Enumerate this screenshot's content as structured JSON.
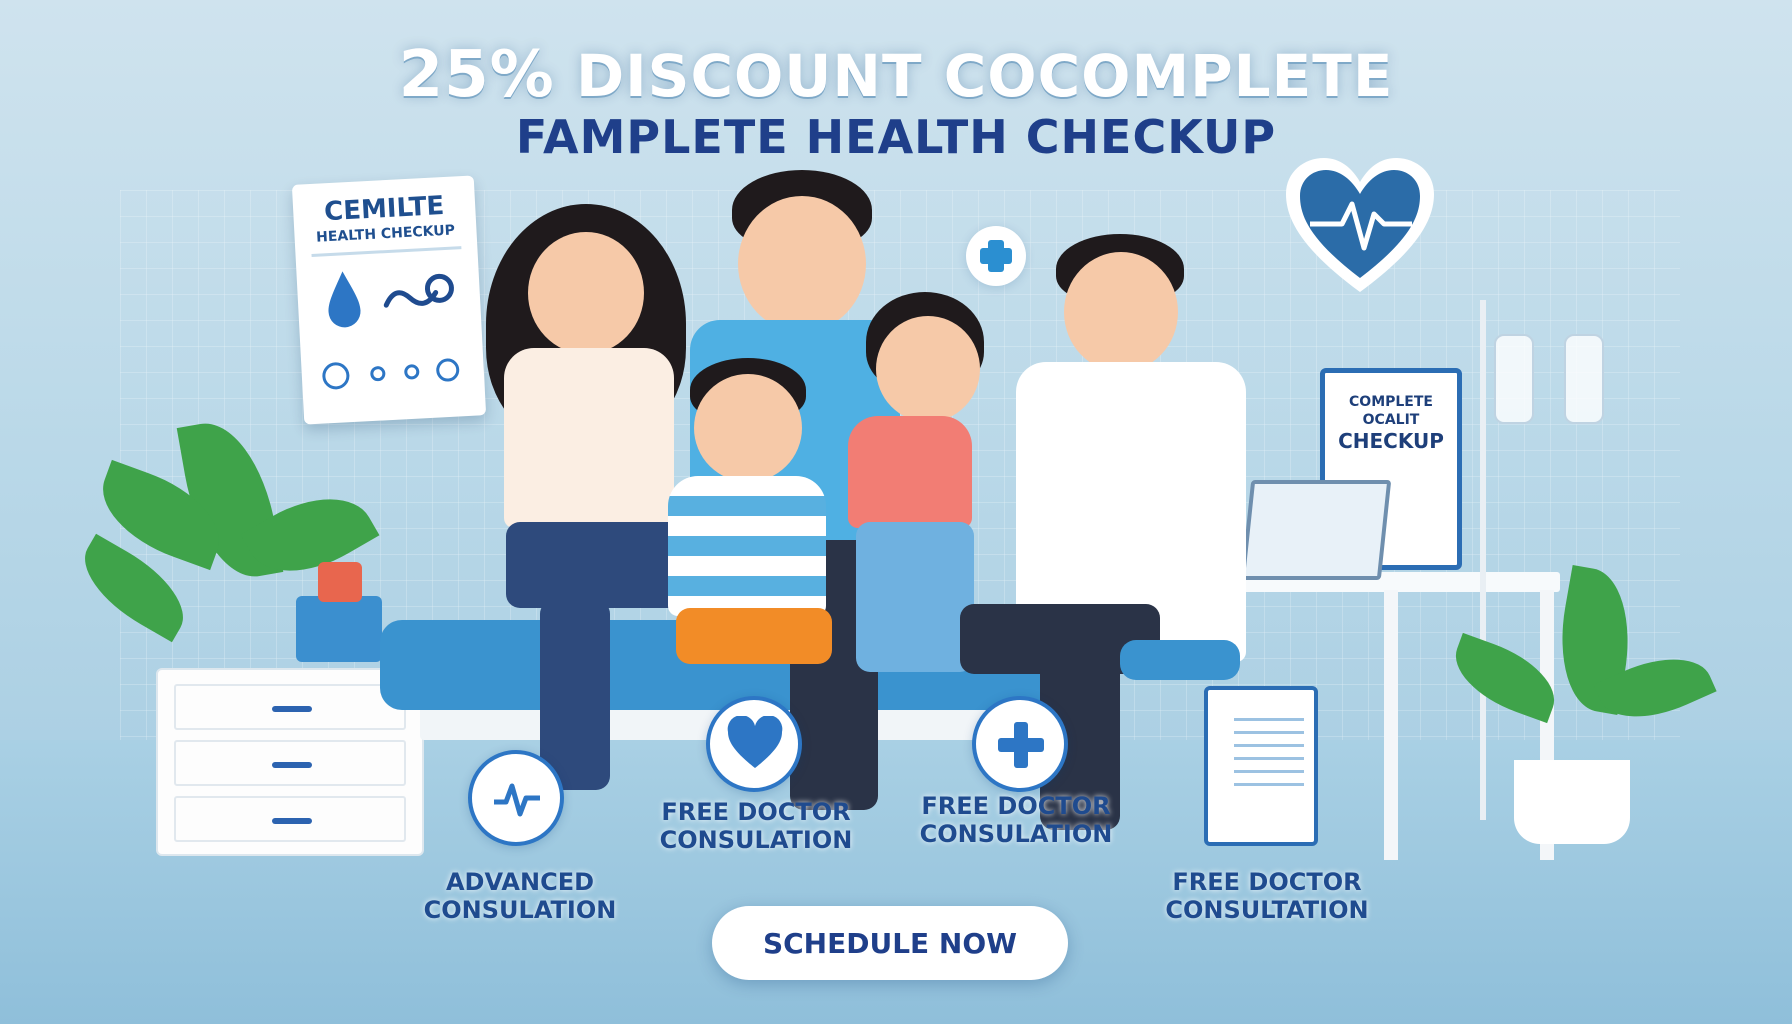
{
  "headline": {
    "line1_pct": "25%",
    "line1_rest": " DISCOUNT COCOMPLETE",
    "line2": "FAMPLETE HEALTH CHECKUP"
  },
  "poster": {
    "title": "CEMILTE",
    "subtitle": "HEALTH CHECKUP"
  },
  "monitor": {
    "line1": "COMPLETE",
    "line2": "OCALIT",
    "line3": "CHECKUP"
  },
  "features": {
    "advanced": {
      "line1": "ADVANCED",
      "line2": "CONSULATION"
    },
    "free_1": {
      "line1": "FREE DOCTOR",
      "line2": "CONSULATION"
    },
    "free_2": {
      "line1": "FREE DOCTOR",
      "line2": "CONSULATION"
    },
    "free_3": {
      "line1": "FREE DOCTOR",
      "line2": "CONSULTATION"
    }
  },
  "cta": {
    "label": "SCHEDULE NOW"
  },
  "colors": {
    "brand_navy": "#1f3f8a",
    "accent_blue": "#2d76c5",
    "background": "#b9d8e8"
  },
  "icons": [
    "heart-pulse-icon",
    "plus-icon",
    "water-drop-icon",
    "stethoscope-icon",
    "clipboard-icon"
  ]
}
